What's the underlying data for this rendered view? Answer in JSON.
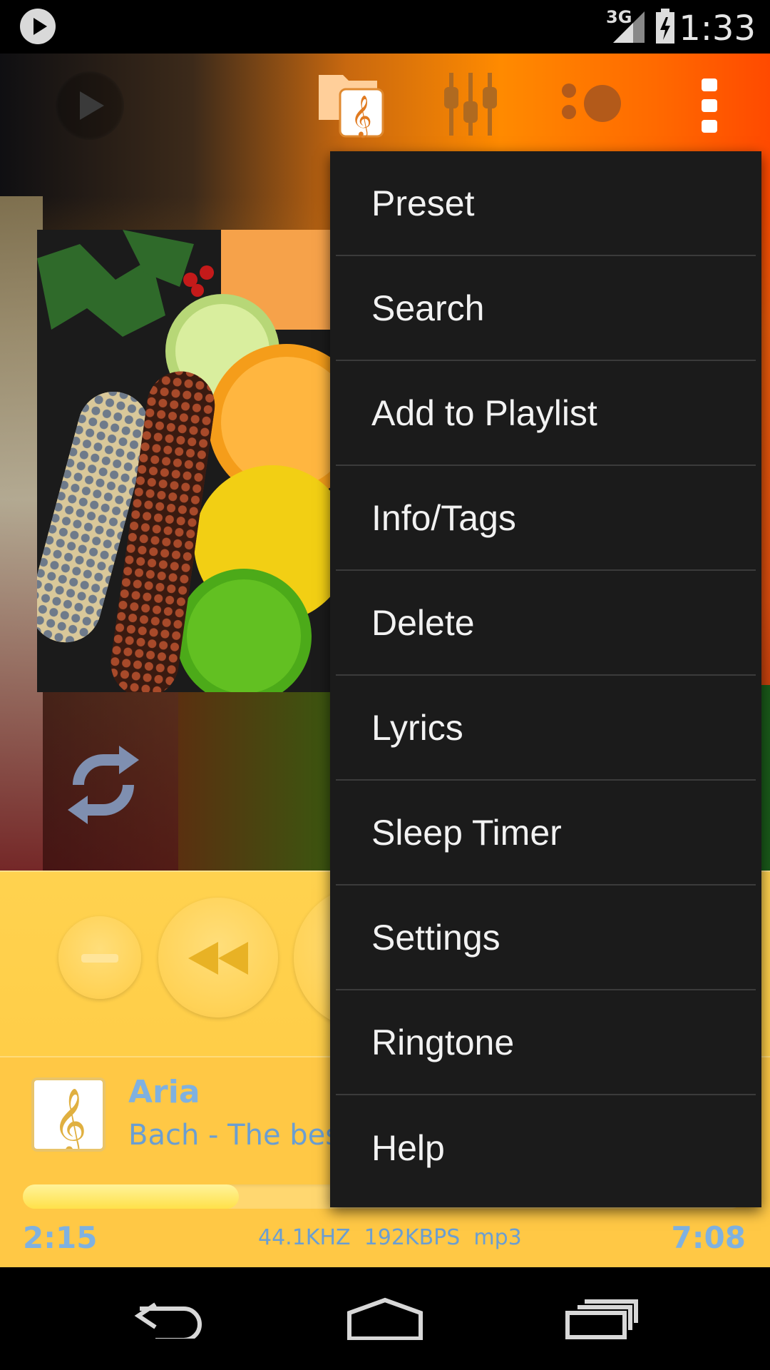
{
  "status_bar": {
    "network": "3G",
    "time": "1:33"
  },
  "toolbar": {
    "icons": [
      "play-icon",
      "music-folder-icon",
      "equalizer-icon",
      "visualizer-icon",
      "overflow-menu-icon"
    ]
  },
  "menu": {
    "items": [
      {
        "label": "Preset"
      },
      {
        "label": "Search"
      },
      {
        "label": "Add to Playlist"
      },
      {
        "label": "Info/Tags"
      },
      {
        "label": "Delete"
      },
      {
        "label": "Lyrics"
      },
      {
        "label": "Sleep Timer"
      },
      {
        "label": "Settings"
      },
      {
        "label": "Ringtone"
      },
      {
        "label": "Help"
      }
    ]
  },
  "now_playing": {
    "title": "Aria",
    "artist": "Bach - The best of classical music",
    "elapsed": "2:15",
    "total": "7:08",
    "sample_rate": "44.1KHZ",
    "bitrate": "192KBPS",
    "format": "mp3",
    "progress": 0.3
  },
  "colors": {
    "accent_yellow": "#ffc845",
    "text_blue": "#7fb1e0",
    "menu_bg": "#1b1b1b"
  }
}
